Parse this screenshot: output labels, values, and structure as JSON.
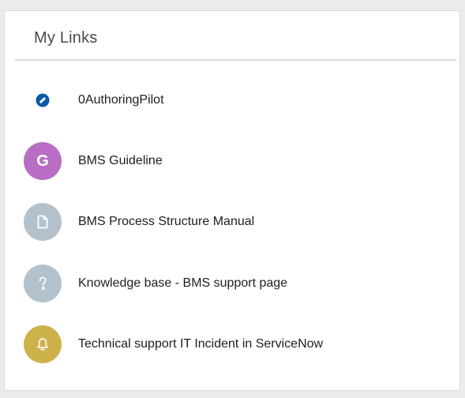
{
  "widget": {
    "title": "My Links"
  },
  "links": [
    {
      "label": "0AuthoringPilot",
      "icon": "authoring-pilot-logo-icon",
      "color": "#0b5aa8"
    },
    {
      "label": "BMS Guideline",
      "icon": "letter-g-avatar",
      "letter": "G",
      "color": "#b86ec4"
    },
    {
      "label": "BMS Process Structure Manual",
      "icon": "document-icon",
      "color": "#b2c1cb"
    },
    {
      "label": "Knowledge base - BMS support page",
      "icon": "question-mark-icon",
      "color": "#b2c1cb"
    },
    {
      "label": "Technical support IT Incident in ServiceNow",
      "icon": "bell-icon",
      "color": "#cdb24c"
    }
  ]
}
